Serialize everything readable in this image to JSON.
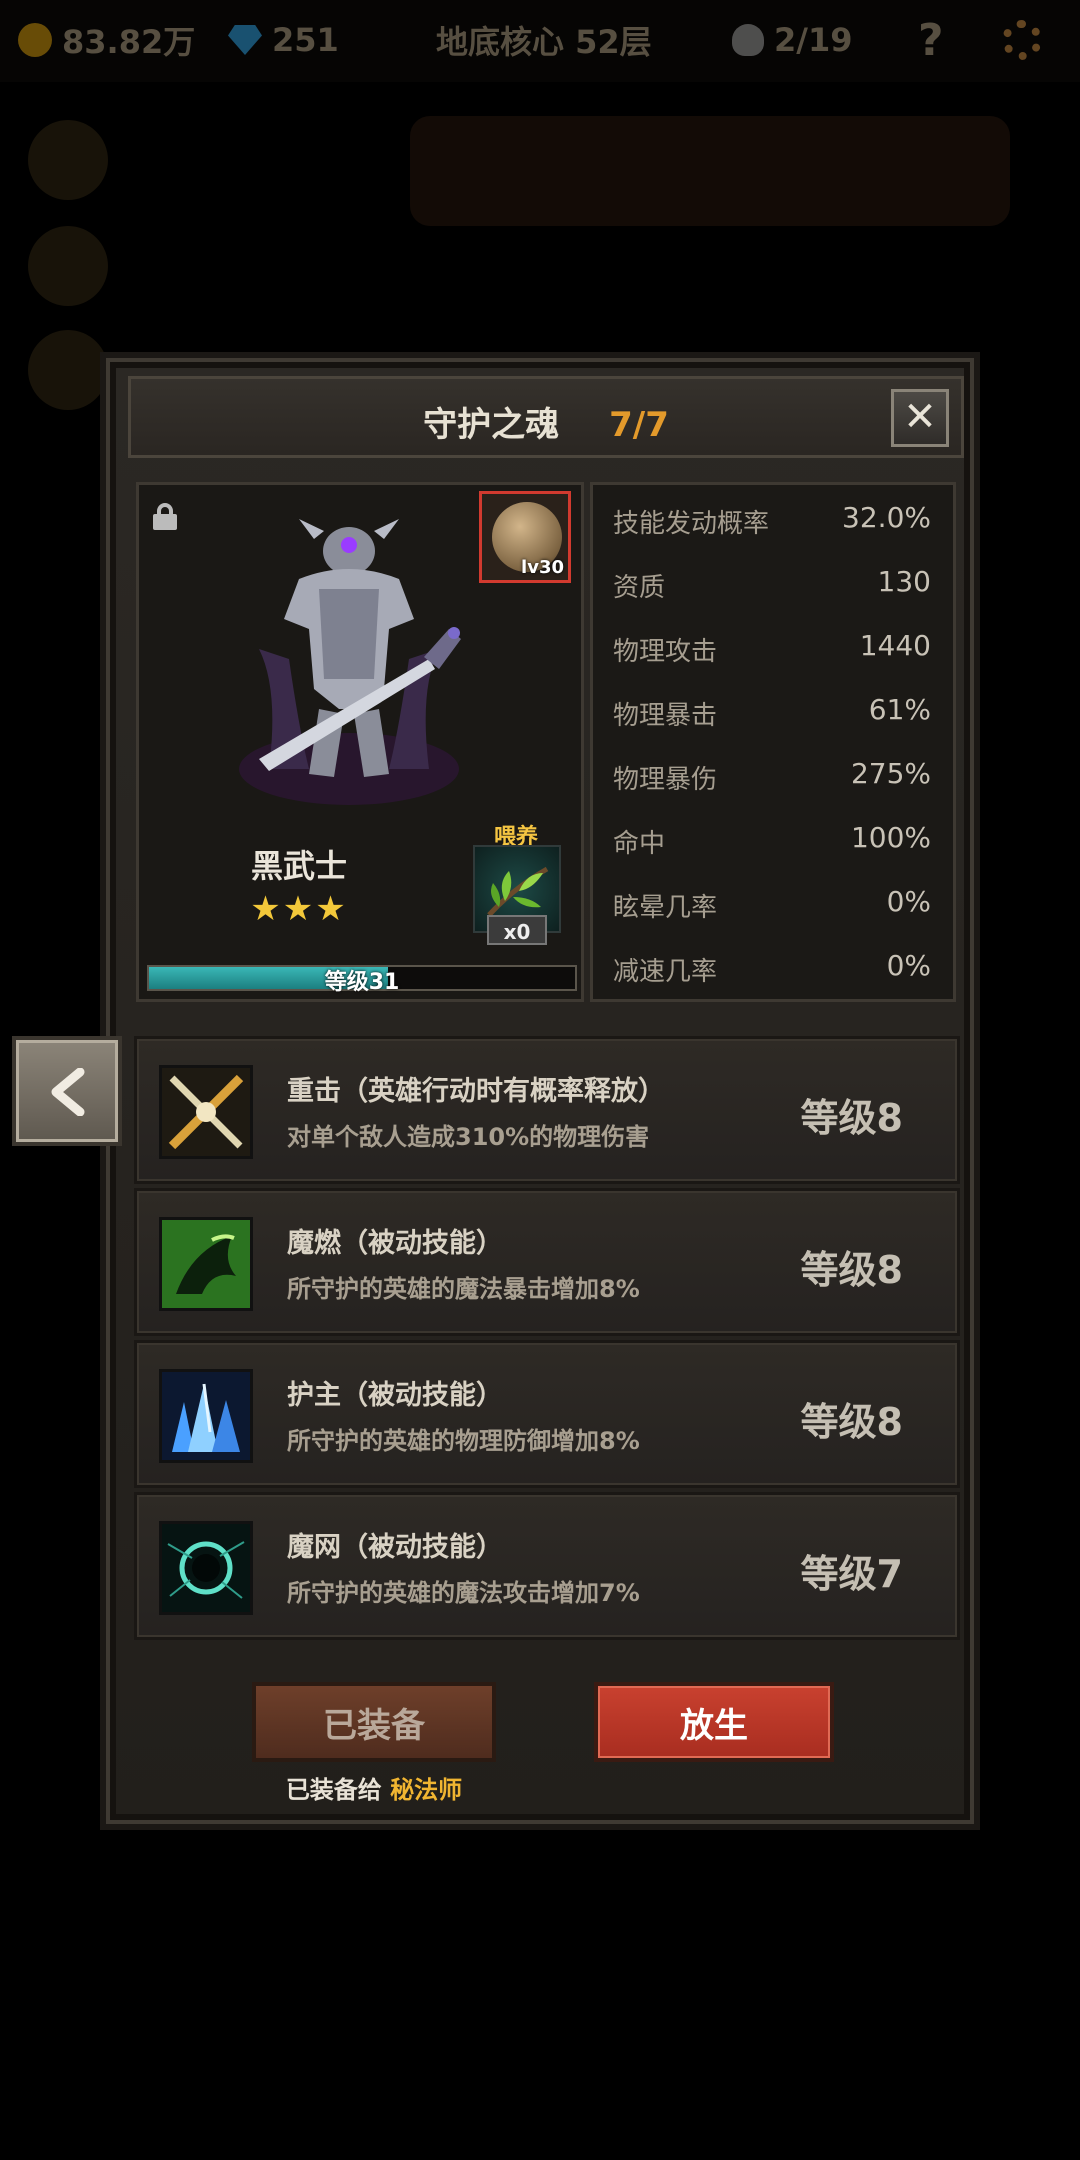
{
  "topbar": {
    "gold": "83.82万",
    "gems": "251",
    "stage": "地底核心 52层",
    "kills": "2/19",
    "help_icon": "?"
  },
  "modal": {
    "title": "守护之魂",
    "count": "7/7",
    "close_icon": "✕"
  },
  "hero": {
    "name": "黑武士",
    "stars": "★★★",
    "star_count": 3,
    "item_level": "lv30",
    "feed_label": "喂养",
    "feed_count": "x0",
    "level_text": "等级31",
    "level_progress": 0.56
  },
  "stats": [
    {
      "label": "技能发动概率",
      "value": "32.0%"
    },
    {
      "label": "资质",
      "value": "130"
    },
    {
      "label": "物理攻击",
      "value": "1440"
    },
    {
      "label": "物理暴击",
      "value": "61%"
    },
    {
      "label": "物理暴伤",
      "value": "275%"
    },
    {
      "label": "命中",
      "value": "100%"
    },
    {
      "label": "眩晕几率",
      "value": "0%"
    },
    {
      "label": "减速几率",
      "value": "0%"
    }
  ],
  "skills": [
    {
      "name": "重击（英雄行动时有概率释放）",
      "desc": "对单个敌人造成310%的物理伤害",
      "level": "等级8",
      "icon": "heavy-strike-icon"
    },
    {
      "name": "魔燃（被动技能）",
      "desc": "所守护的英雄的魔法暴击增加8%",
      "level": "等级8",
      "icon": "magic-burn-icon"
    },
    {
      "name": "护主（被动技能）",
      "desc": "所守护的英雄的物理防御增加8%",
      "level": "等级8",
      "icon": "guard-crystal-icon"
    },
    {
      "name": "魔网（被动技能）",
      "desc": "所守护的英雄的魔法攻击增加7%",
      "level": "等级7",
      "icon": "magic-web-icon"
    }
  ],
  "footer": {
    "equipped_label": "已装备",
    "release_label": "放生",
    "equip_note_prefix": "已装备给",
    "equip_note_hero": "秘法师"
  },
  "colors": {
    "accent": "#e39a2b",
    "danger": "#c9412f",
    "level_bar": "#2aa3a3"
  }
}
